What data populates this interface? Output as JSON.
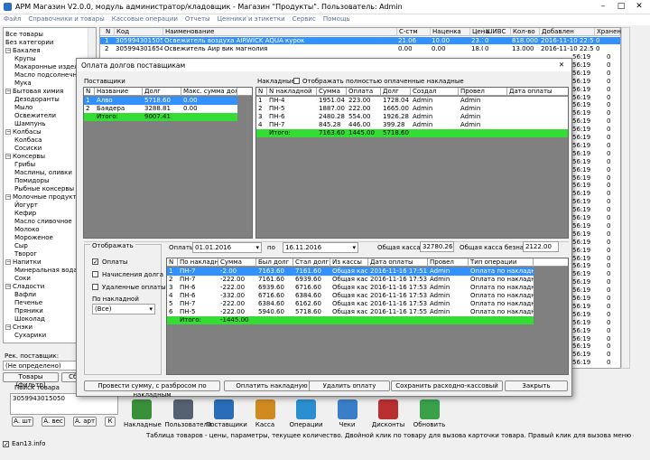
{
  "window": {
    "title": "АРМ Магазин V2.0.0, модуль администратор/кладовщик - Магазин \"Продукты\". Пользователь: Admin"
  },
  "menu": [
    "Файл",
    "Справочники и товары",
    "Кассовые операции",
    "Отчеты",
    "Ценники и этикетки",
    "Сервис",
    "Помощь"
  ],
  "tree": [
    {
      "t": "Все товары",
      "l": 0,
      "b": ""
    },
    {
      "t": "Без категории",
      "l": 0,
      "b": ""
    },
    {
      "t": "Бакалея",
      "l": 0,
      "b": "−"
    },
    {
      "t": "Крупы",
      "l": 1,
      "b": ""
    },
    {
      "t": "Макаронные изделия",
      "l": 1,
      "b": ""
    },
    {
      "t": "Масло подсолнечное",
      "l": 1,
      "b": ""
    },
    {
      "t": "Мука",
      "l": 1,
      "b": ""
    },
    {
      "t": "Бытовая химия",
      "l": 0,
      "b": "−"
    },
    {
      "t": "Дезодоранты",
      "l": 1,
      "b": ""
    },
    {
      "t": "Мыло",
      "l": 1,
      "b": ""
    },
    {
      "t": "Освежители",
      "l": 1,
      "b": ""
    },
    {
      "t": "Шампунь",
      "l": 1,
      "b": ""
    },
    {
      "t": "Колбасы",
      "l": 0,
      "b": "−"
    },
    {
      "t": "Колбаса",
      "l": 1,
      "b": ""
    },
    {
      "t": "Сосиски",
      "l": 1,
      "b": ""
    },
    {
      "t": "Консервы",
      "l": 0,
      "b": "−"
    },
    {
      "t": "Грибы",
      "l": 1,
      "b": ""
    },
    {
      "t": "Маслины, оливки",
      "l": 1,
      "b": ""
    },
    {
      "t": "Помидоры",
      "l": 1,
      "b": ""
    },
    {
      "t": "Рыбные консервы",
      "l": 1,
      "b": ""
    },
    {
      "t": "Молочные продукты",
      "l": 0,
      "b": "−"
    },
    {
      "t": "Йогурт",
      "l": 1,
      "b": ""
    },
    {
      "t": "Кефир",
      "l": 1,
      "b": ""
    },
    {
      "t": "Масло сливочное",
      "l": 1,
      "b": ""
    },
    {
      "t": "Молоко",
      "l": 1,
      "b": ""
    },
    {
      "t": "Мороженое",
      "l": 1,
      "b": ""
    },
    {
      "t": "Сыр",
      "l": 1,
      "b": ""
    },
    {
      "t": "Творог",
      "l": 1,
      "b": ""
    },
    {
      "t": "Напитки",
      "l": 0,
      "b": "−"
    },
    {
      "t": "Минеральная вода",
      "l": 1,
      "b": ""
    },
    {
      "t": "Соки",
      "l": 1,
      "b": ""
    },
    {
      "t": "Сладости",
      "l": 0,
      "b": "−"
    },
    {
      "t": "Вафли",
      "l": 1,
      "b": ""
    },
    {
      "t": "Печенье",
      "l": 1,
      "b": ""
    },
    {
      "t": "Пряники",
      "l": 1,
      "b": ""
    },
    {
      "t": "Шоколад",
      "l": 1,
      "b": ""
    },
    {
      "t": "Снэки",
      "l": 0,
      "b": "−"
    },
    {
      "t": "Сухарики",
      "l": 1,
      "b": ""
    }
  ],
  "grid": {
    "headers": [
      [
        "N",
        4
      ],
      [
        "Код",
        16
      ],
      [
        "Наименование",
        70
      ],
      [
        "С-стм",
        329
      ],
      [
        "Наценка",
        366
      ],
      [
        "Цена",
        410
      ],
      [
        "ШИВС",
        425
      ],
      [
        "Кол-во",
        455
      ],
      [
        "Добавлен",
        487
      ],
      [
        "Хранение",
        548
      ]
    ],
    "rows": [
      [
        "1",
        "3059943015050",
        "Освежитель воздуха AIRWICK AQUA курок",
        "21.06",
        "10.00",
        "23.15",
        "0",
        "818.000",
        "2016-11-10 22:56:18",
        "0"
      ],
      [
        "2",
        "3059943016546",
        "Освежитель Аир вик магнолия",
        "0.00",
        "0.00",
        "18.00",
        "0",
        "13.000",
        "2016-11-10 22:56:19",
        "0"
      ]
    ],
    "side_times": [
      "56:19",
      "56:19",
      "56:19",
      "56:19",
      "56:19",
      "56:19",
      "56:19",
      "56:19",
      "56:19",
      "56:19",
      "56:19",
      "56:19",
      "56:19",
      "56:19",
      "56:19",
      "56:19",
      "56:19",
      "56:19",
      "56:19",
      "56:19",
      "56:19",
      "56:19",
      "56:19",
      "56:19",
      "56:19",
      "56:19",
      "56:19",
      "56:19",
      "56:19",
      "56:19",
      "56:19",
      "56:19",
      "56:19",
      "56:19",
      "56:19",
      "56:19",
      "56:19",
      "56:19",
      "56:19",
      "56:19",
      "56:19"
    ],
    "side_counts": [
      "0",
      "0",
      "0",
      "0",
      "0",
      "0",
      "0",
      "0",
      "0",
      "0",
      "0",
      "0",
      "0",
      "0",
      "0",
      "0",
      "0",
      "0",
      "0",
      "0",
      "0",
      "0",
      "0",
      "0",
      "0",
      "0",
      "0",
      "0",
      "0",
      "0",
      "0",
      "0",
      "0",
      "0",
      "0",
      "0",
      "0",
      "0",
      "0",
      "0",
      "0"
    ]
  },
  "left": {
    "supplier_label": "Рек. поставщик:",
    "supplier_value": "(Не определено)",
    "btn_filter": "Товары (фильтр)",
    "btn_reset": "Сброс",
    "search_label": "Поиск товара",
    "search_value": "3059943015050",
    "btn_sh": "А. шт",
    "btn_ves": "А. вес",
    "btn_art": "А. арт",
    "btn_k": "К",
    "ean_label": "Ean13.info"
  },
  "toolbar": [
    {
      "l": "Накладные",
      "c": "#3a8f3a"
    },
    {
      "l": "Пользователи",
      "c": "#556070"
    },
    {
      "l": "Поставщики",
      "c": "#2a6cb8"
    },
    {
      "l": "Касса",
      "c": "#d08a20"
    },
    {
      "l": "Операции",
      "c": "#2a8fd0"
    },
    {
      "l": "Чеки",
      "c": "#3a7ec8"
    },
    {
      "l": "Дисконты",
      "c": "#b83030"
    },
    {
      "l": "Обновить",
      "c": "#3aa04a"
    }
  ],
  "status": "Таблица товаров - цены, параметры, текущее количество. Двойной клик по товару для вызова карточки товара. Правый клик для вызова меню операций с товаром.",
  "dialog": {
    "title": "Оплата долгов поставщикам",
    "suppliers_label": "Поставщики",
    "sup_headers": [
      [
        "N",
        0,
        12
      ],
      [
        "Название",
        12,
        65
      ],
      [
        "Долг",
        65,
        108
      ],
      [
        "Макс. сумма долга",
        108,
        170
      ]
    ],
    "suppliers": [
      [
        "1",
        "Алво",
        "5718.60",
        "0.00"
      ],
      [
        "2",
        "Баядера",
        "3288.81",
        "0.00"
      ]
    ],
    "sup_total": [
      "",
      "Итого:",
      "9007.41",
      ""
    ],
    "invoices_label": "Накладные",
    "invoices_check": "Отображать полностью оплаченные накладные",
    "inv_headers": [
      [
        "N",
        0,
        12
      ],
      [
        "N накладной",
        12,
        67
      ],
      [
        "Сумма",
        67,
        100
      ],
      [
        "Оплата",
        100,
        138
      ],
      [
        "Долг",
        138,
        171
      ],
      [
        "Создал",
        171,
        224
      ],
      [
        "Провел",
        224,
        278
      ],
      [
        "Дата оплаты",
        278,
        348
      ]
    ],
    "invoices": [
      [
        "1",
        "ПН-4",
        "1951.04",
        "223.00",
        "1728.04",
        "Admin",
        "Admin",
        ""
      ],
      [
        "2",
        "ПН-5",
        "1887.00",
        "222.00",
        "1665.00",
        "Admin",
        "Admin",
        ""
      ],
      [
        "3",
        "ПН-6",
        "2480.28",
        "554.00",
        "1926.28",
        "Admin",
        "Admin",
        ""
      ],
      [
        "4",
        "ПН-7",
        "845.28",
        "446.00",
        "399.28",
        "Admin",
        "Admin",
        ""
      ]
    ],
    "inv_total": [
      "",
      "Итого:",
      "7163.60",
      "1445.00",
      "5718.60",
      "",
      "",
      ""
    ],
    "display_label": "Отображать",
    "cb_pay": "Оплаты",
    "cb_accrual": "Начисления долга",
    "cb_deleted": "Удаленные оплаты",
    "by_invoice_label": "По накладной",
    "by_invoice_value": "(Все)",
    "pay_from_label": "Оплаты с",
    "date_from": "01.01.2016",
    "to_label": "по",
    "date_to": "16.11.2016",
    "total_cash_label": "Общая касса",
    "total_cash": "32780.26",
    "total_cashless_label": "Общая касса безнал",
    "total_cashless": "2122.00",
    "pay_headers": [
      [
        "N",
        0,
        12
      ],
      [
        "По накладной",
        12,
        57
      ],
      [
        "Сумма",
        57,
        99
      ],
      [
        "Был долг",
        99,
        140
      ],
      [
        "Стал долг",
        140,
        181
      ],
      [
        "Из кассы",
        181,
        223
      ],
      [
        "Дата оплаты",
        223,
        289
      ],
      [
        "Провел",
        289,
        334
      ],
      [
        "Тип операции",
        334,
        406
      ]
    ],
    "payments": [
      [
        "1",
        "ПН-7",
        "-2.00",
        "7163.60",
        "7161.60",
        "Общая касса",
        "2016-11-16 17:51:57",
        "Admin",
        "Оплата по накладной"
      ],
      [
        "2",
        "ПН-7",
        "-222.00",
        "7161.60",
        "6939.60",
        "Общая касса",
        "2016-11-16 17:53:05",
        "Admin",
        "Оплата по накладной"
      ],
      [
        "3",
        "ПН-6",
        "-222.00",
        "6939.60",
        "6716.60",
        "Общая касса",
        "2016-11-16 17:53:16",
        "Admin",
        "Оплата по накладной"
      ],
      [
        "4",
        "ПН-6",
        "-332.00",
        "6716.60",
        "6384.60",
        "Общая касса",
        "2016-11-16 17:53:32",
        "Admin",
        "Оплата по накладной"
      ],
      [
        "5",
        "ПН-7",
        "-222.00",
        "6384.60",
        "6162.60",
        "Общая касса",
        "2016-11-16 17:53:39",
        "Admin",
        "Оплата по накладной"
      ],
      [
        "6",
        "ПН-5",
        "-222.00",
        "5940.60",
        "5718.60",
        "Общая касса",
        "2016-11-16 17:55:24",
        "Admin",
        "Оплата по накладной"
      ]
    ],
    "pay_total": [
      "",
      "Итого:",
      "-1445.00",
      "",
      "",
      "",
      "",
      "",
      ""
    ],
    "btn_spread": "Провести сумму, с разбросом по накладным",
    "btn_pay": "Оплатить накладную",
    "btn_delete": "Удалить оплату",
    "btn_save": "Сохранить расходно-кассовый",
    "btn_close": "Закрыть"
  }
}
